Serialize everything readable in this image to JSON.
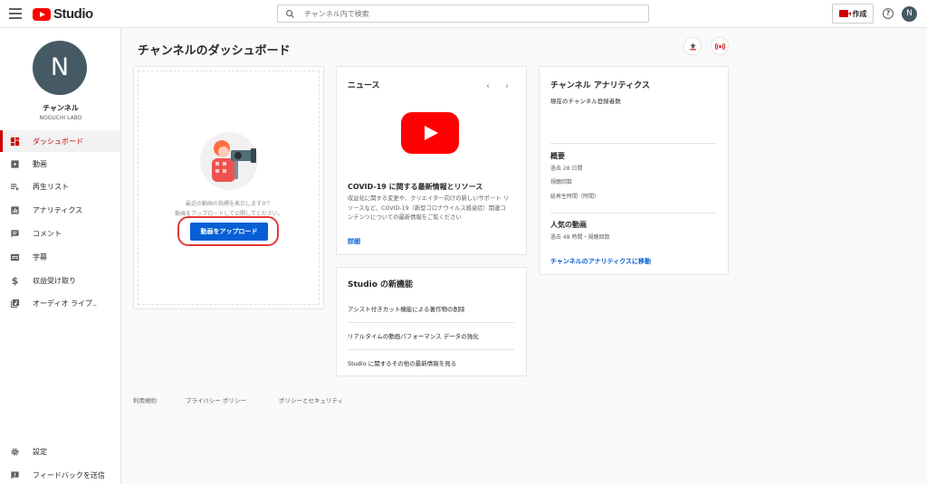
{
  "header": {
    "logo_text": "Studio",
    "search_placeholder": "チャンネル内で検索",
    "create_label": "作成",
    "help_glyph": "?",
    "avatar_initial": "N"
  },
  "sidebar": {
    "avatar_initial": "N",
    "channel_name": "チャンネル",
    "channel_sub": "NOGUCHI LABO",
    "items": [
      {
        "label": "ダッシュボード",
        "icon": "dashboard-icon"
      },
      {
        "label": "動画",
        "icon": "video-icon"
      },
      {
        "label": "再生リスト",
        "icon": "playlist-icon"
      },
      {
        "label": "アナリティクス",
        "icon": "analytics-icon"
      },
      {
        "label": "コメント",
        "icon": "comment-icon"
      },
      {
        "label": "字幕",
        "icon": "subtitles-icon"
      },
      {
        "label": "収益受け取り",
        "icon": "dollar-icon"
      },
      {
        "label": "オーディオ ライブ..",
        "icon": "audio-library-icon"
      }
    ],
    "bottom_items": [
      {
        "label": "設定",
        "icon": "settings-icon"
      },
      {
        "label": "フィードバックを送信",
        "icon": "feedback-icon"
      }
    ]
  },
  "main": {
    "title": "チャンネルのダッシュボード",
    "upload_card": {
      "line1": "最近の動画の指標を表示しますか？",
      "line2": "動画をアップロードして公開してください。",
      "button": "動画をアップロード"
    },
    "news_card": {
      "title": "ニュース",
      "prev": "‹",
      "next": "›",
      "headline": "COVID-19 に関する最新情報とリソース",
      "body": "収益化に関する変更や、クリエイター向けの新しいサポート リソースなど、COVID-19（新型コロナウイルス感染症）関連コンテンツについての最新情報をご覧ください",
      "link": "詳細"
    },
    "features_card": {
      "title": "Studio の新機能",
      "items": [
        "アシスト付きカット機能による著作物の削除",
        "リアルタイムの動画パフォーマンス データの強化",
        "Studio に関するその他の最新情報を見る"
      ]
    },
    "analytics_card": {
      "title": "チャンネル アナリティクス",
      "subscribers_label": "現在のチャンネル登録者数",
      "summary_title": "概要",
      "summary_period": "過去 28 日間",
      "views_label": "視聴回数",
      "watch_time_label": "総再生時間（時間）",
      "popular_title": "人気の動画",
      "popular_period": "過去 48 時間・視聴回数",
      "link": "チャンネルのアナリティクスに移動"
    }
  },
  "footer": {
    "links": [
      "利用規約",
      "プライバシー ポリシー",
      "ポリシーとセキュリティ"
    ]
  },
  "colors": {
    "accent_red": "#cc0000",
    "youtube_red": "#ff0000",
    "link_blue": "#065fd4",
    "highlight_ring": "#e53935"
  }
}
